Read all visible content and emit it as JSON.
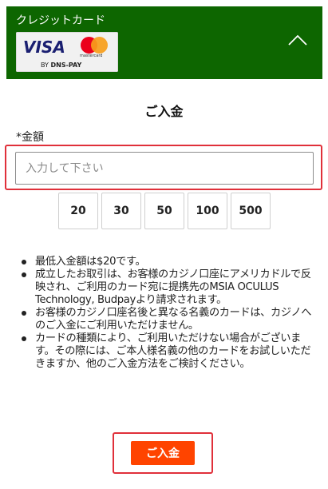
{
  "header": {
    "title": "クレジットカード",
    "bg_color": "#0d6600",
    "logos": {
      "visa": "VISA",
      "mastercard": "mastercard",
      "provider_prefix": "BY",
      "provider": "DNS-PAY"
    },
    "collapse_icon": "chevron-up-icon"
  },
  "form": {
    "title": "ご入金",
    "amount_label": "*金額",
    "amount_placeholder": "入力して下さい",
    "amount_value": "",
    "quick_amounts": [
      "20",
      "30",
      "50",
      "100",
      "500"
    ]
  },
  "notes": [
    "最低入金額は$20です。",
    "成立したお取引は、お客様のカジノ口座にアメリカドルで反映され、ご利用のカード宛に提携先のMSIA OCULUS Technology, Budpayより請求されます。",
    "お客様のカジノ口座名後と異なる名義のカードは、カジノへのご入金にご利用いただけません。",
    "カードの種類により、ご利用いただけない場合がございます。その際には、ご本人様名義の他のカードをお試しいただきますか、他のご入金方法をご検討ください。"
  ],
  "submit": {
    "label": "ご入金",
    "color": "#ff4400"
  },
  "highlight_color": "#e0303a"
}
